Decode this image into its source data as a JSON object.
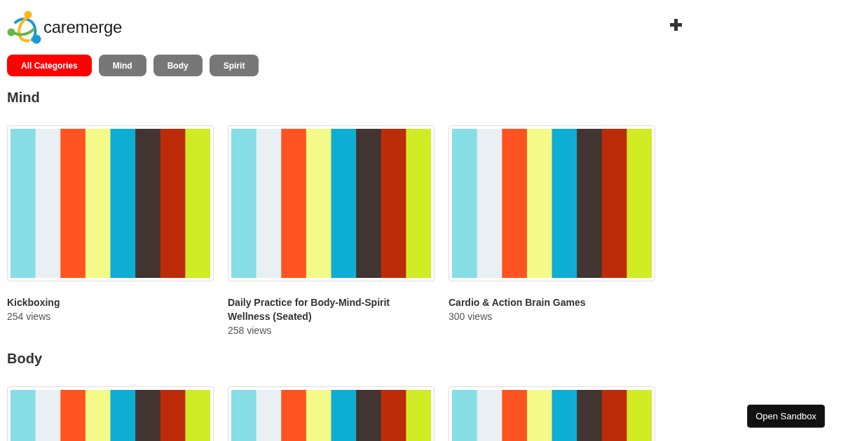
{
  "header": {
    "brand": "caremerge"
  },
  "filters": [
    {
      "label": "All Categories",
      "selected": true
    },
    {
      "label": "Mind",
      "selected": false
    },
    {
      "label": "Body",
      "selected": false
    },
    {
      "label": "Spirit",
      "selected": false
    }
  ],
  "sections": [
    {
      "title": "Mind",
      "items": [
        {
          "kind": "video",
          "title": "Kickboxing",
          "views": "254 views"
        },
        {
          "kind": "video",
          "title": "Daily Practice for Body-Mind-Spirit Wellness (Seated)",
          "views": "258 views"
        },
        {
          "kind": "video",
          "title": "Cardio & Action Brain Games",
          "views": "300 views"
        }
      ]
    },
    {
      "title": "Body",
      "items": [
        {
          "kind": "video"
        },
        {
          "kind": "video"
        },
        {
          "kind": "video"
        }
      ]
    }
  ],
  "sandbox_button": {
    "label": "Open Sandbox"
  }
}
